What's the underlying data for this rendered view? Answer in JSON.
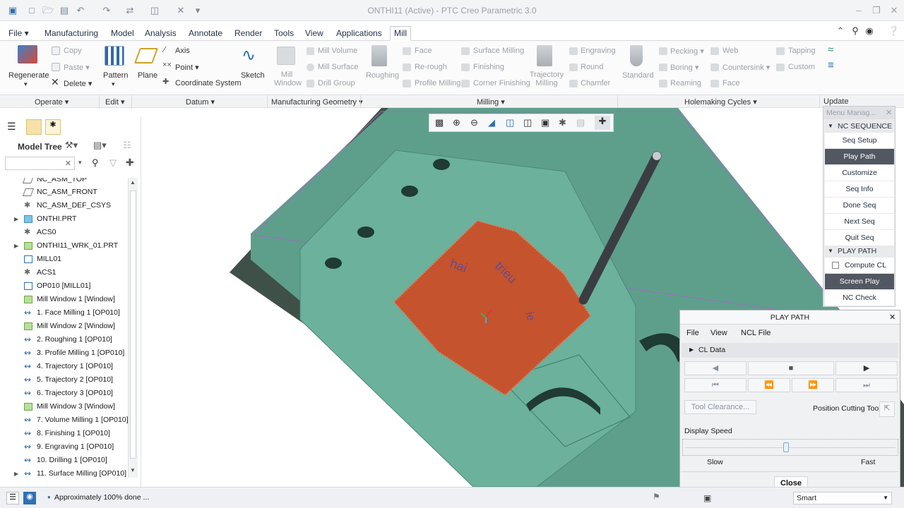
{
  "window": {
    "title": "ONTHI11 (Active) - PTC Creo Parametric 3.0"
  },
  "tabs": [
    "File",
    "Manufacturing",
    "Model",
    "Analysis",
    "Annotate",
    "Render",
    "Tools",
    "View",
    "Applications",
    "Mill"
  ],
  "ribbon": {
    "regenerate": "Regenerate",
    "copy": "Copy",
    "paste": "Paste",
    "delete": "Delete",
    "pattern": "Pattern",
    "plane": "Plane",
    "axis": "Axis",
    "point": "Point",
    "coordinate_system": "Coordinate System",
    "sketch": "Sketch",
    "mill_window": "Mill\nWindow",
    "mill_volume": "Mill Volume",
    "mill_surface": "Mill Surface",
    "drill_group": "Drill Group",
    "roughing": "Roughing",
    "face": "Face",
    "re_rough": "Re-rough",
    "profile_milling": "Profile Milling",
    "surface_milling": "Surface Milling",
    "finishing": "Finishing",
    "corner_finishing": "Corner Finishing",
    "trajectory_milling": "Trajectory\nMilling",
    "engraving": "Engraving",
    "round": "Round",
    "chamfer": "Chamfer",
    "standard": "Standard",
    "pecking": "Pecking",
    "boring": "Boring",
    "reaming": "Reaming",
    "web": "Web",
    "countersink": "Countersink",
    "face2": "Face",
    "tapping": "Tapping",
    "custom": "Custom"
  },
  "groups": {
    "operate": "Operate",
    "edit": "Edit",
    "datum": "Datum",
    "manufacturing_geometry": "Manufacturing Geometry",
    "milling": "Milling",
    "holemaking_cycles": "Holemaking Cycles",
    "update": "Update"
  },
  "model_tree": {
    "title": "Model Tree",
    "items": [
      "NC_ASM_TOP",
      "NC_ASM_FRONT",
      "NC_ASM_DEF_CSYS",
      "ONTHI.PRT",
      "ACS0",
      "ONTHI11_WRK_01.PRT",
      "MILL01",
      "ACS1",
      "OP010 [MILL01]",
      "Mill Window 1 [Window]",
      "1. Face Milling 1 [OP010]",
      "Mill Window 2 [Window]",
      "2. Roughing 1 [OP010]",
      "3. Profile Milling 1 [OP010]",
      "4. Trajectory 1 [OP010]",
      "5. Trajectory 2 [OP010]",
      "6. Trajectory 3 [OP010]",
      "Mill Window 3 [Window]",
      "7. Volume Milling 1 [OP010]",
      "8. Finishing 1 [OP010]",
      "9. Engraving 1 [OP010]",
      "10. Drilling 1 [OP010]",
      "11. Surface Milling [OP010]"
    ]
  },
  "viewport": {
    "engraved_text_1": "hai",
    "engraved_text_2": "trieu",
    "engraved_text_3": "ie"
  },
  "menu_manager": {
    "title": "Menu Manag...",
    "nc_sequence": "NC SEQUENCE",
    "seq_items": [
      "Seq Setup",
      "Play Path",
      "Customize",
      "Seq Info",
      "Done Seq",
      "Next Seq",
      "Quit Seq"
    ],
    "play_path": "PLAY PATH",
    "play_items": [
      "Compute CL",
      "Screen Play",
      "NC Check"
    ]
  },
  "play_path_dialog": {
    "title": "PLAY PATH",
    "menu": [
      "File",
      "View",
      "NCL File"
    ],
    "cl_data": "CL Data",
    "tool_clearance": "Tool Clearance...",
    "position_cutting_tool": "Position Cutting Tool",
    "display_speed": "Display Speed",
    "slow": "Slow",
    "fast": "Fast",
    "close": "Close",
    "speed_level": 0.48
  },
  "status": {
    "message": "Approximately 100% done ...",
    "filter": "Smart"
  },
  "colors": {
    "part": "#5fa58e",
    "toolpath": "#c5532e",
    "tool": "#3a3e42",
    "selected": "#525861"
  }
}
